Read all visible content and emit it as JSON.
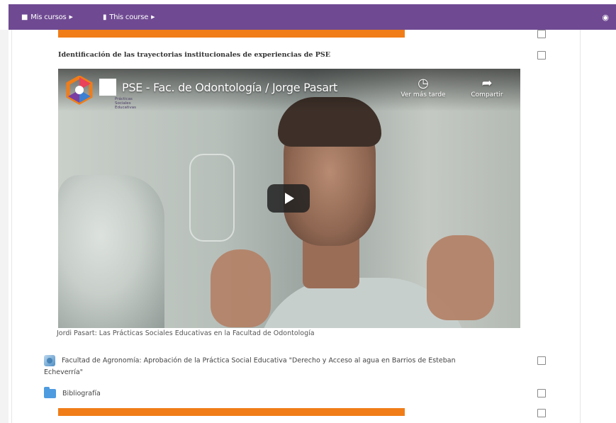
{
  "navbar": {
    "my_courses": "Mis cursos",
    "this_course": "This course"
  },
  "section": {
    "title": "Identificación de las trayectorias institucionales de experiencias de PSE"
  },
  "video": {
    "title": "PSE - Fac. de Odontología / Jorge Pasart",
    "watch_later": "Ver más tarde",
    "share": "Compartir",
    "logo_text": "Prácticas\nSociales\nEducativas",
    "caption": "Jordi Pasart: Las Prácticas Sociales Educativas en la Facultad de Odontología"
  },
  "activities": [
    {
      "type": "page",
      "icon": "document-icon",
      "label_line1": "Facultad de Agronomía: Aprobación de la Práctica Social Educativa \"Derecho y Acceso al agua en Barrios de Esteban",
      "label_line2": "Echeverría\""
    },
    {
      "type": "folder",
      "icon": "folder-icon",
      "label_line1": "Bibliografía"
    }
  ],
  "colors": {
    "navbar": "#6f4a92",
    "accent_bar": "#f07d18"
  }
}
